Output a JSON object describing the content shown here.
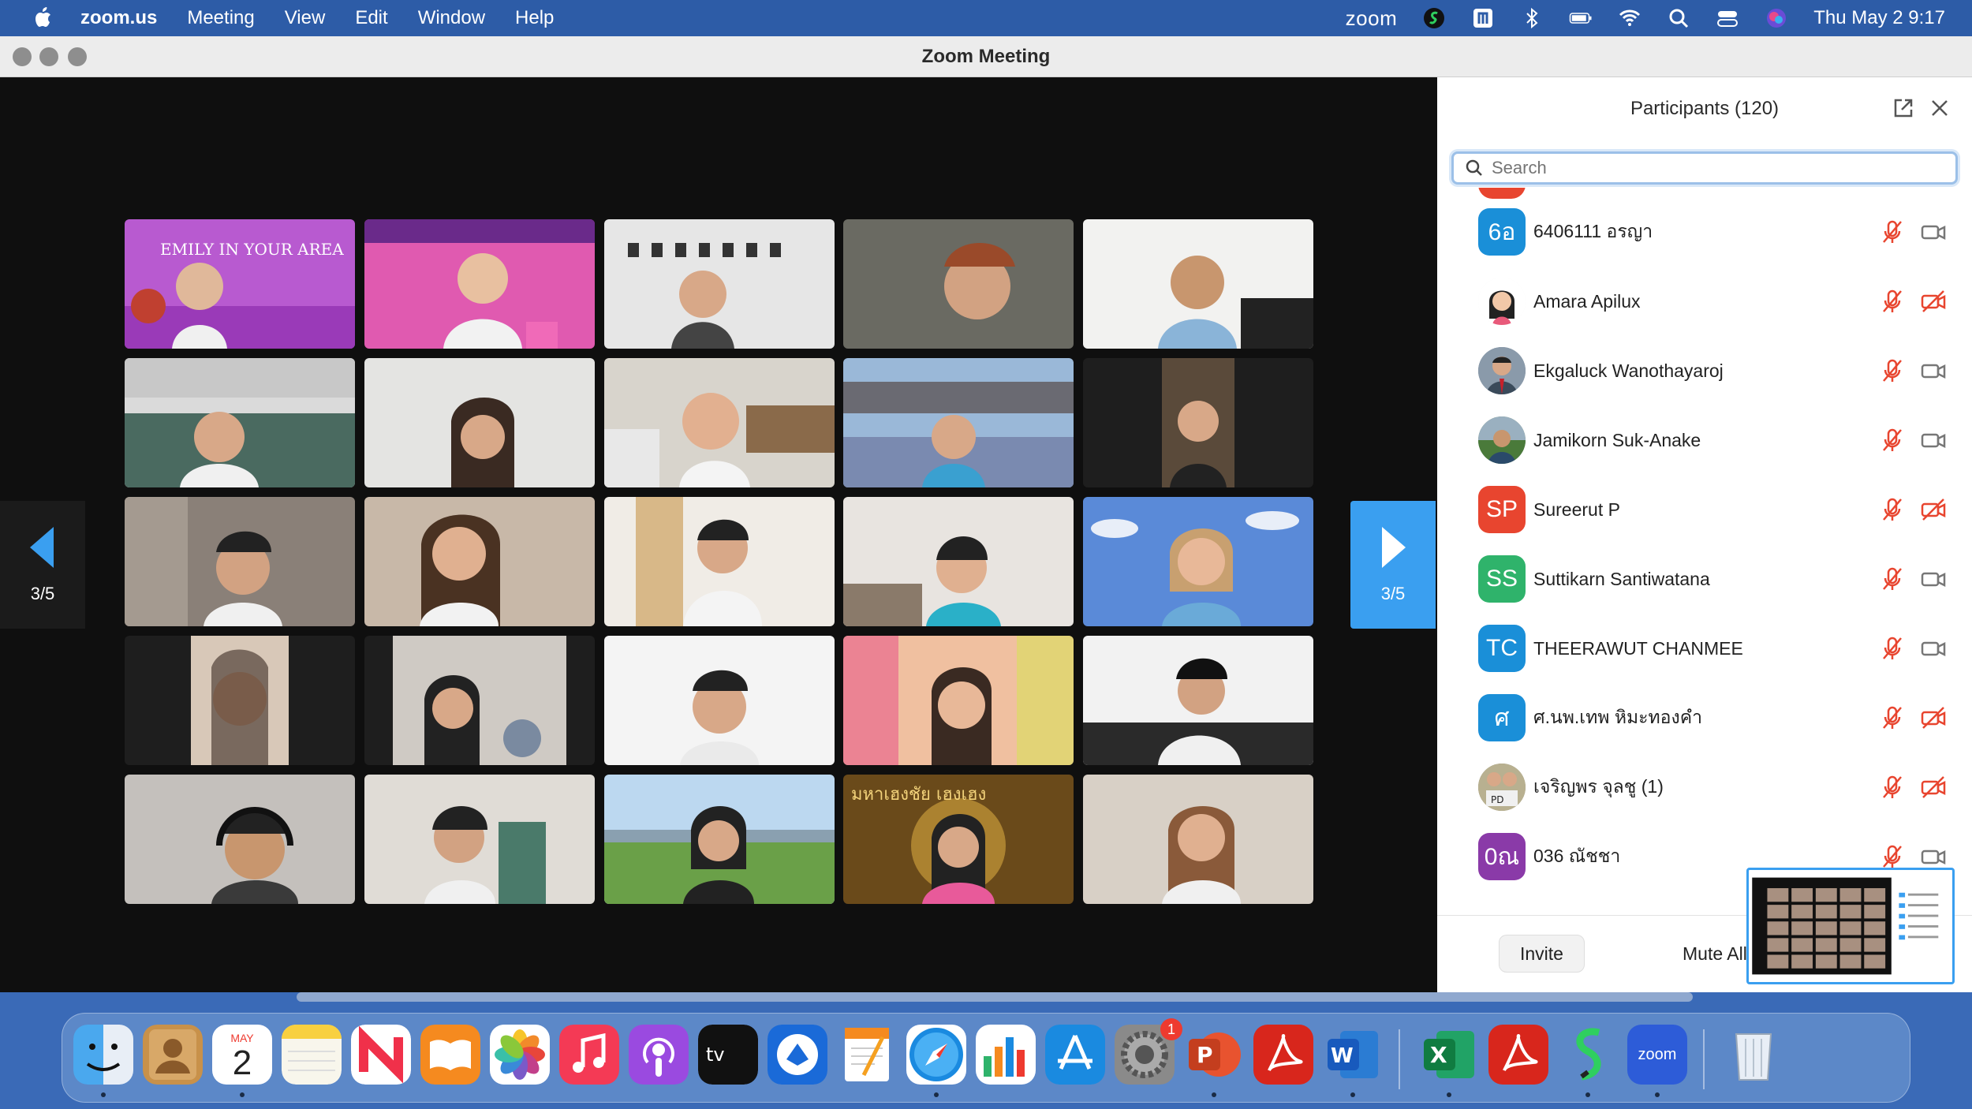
{
  "menubar": {
    "app_name": "zoom.us",
    "menus": [
      "Meeting",
      "View",
      "Edit",
      "Window",
      "Help"
    ],
    "zoom_label": "zoom",
    "datetime": "Thu May 2  9:17"
  },
  "window": {
    "title": "Zoom Meeting"
  },
  "gallery": {
    "page_indicator_prev": "3/5",
    "page_indicator_next": "3/5",
    "tile_count": 25
  },
  "participants": {
    "title": "Participants (120)",
    "search_placeholder": "Search",
    "list": [
      {
        "initials": "6อ",
        "name": "6406111 อรญา",
        "avatar_color": "#1a8fd8",
        "mic": "muted",
        "cam": "on"
      },
      {
        "initials": "",
        "name": "Amara Apilux",
        "avatar_color": "#f4f4f4",
        "mic": "muted",
        "cam": "off"
      },
      {
        "initials": "",
        "name": "Ekgaluck Wanothayaroj",
        "avatar_color": "#7a8a9a",
        "mic": "muted",
        "cam": "on"
      },
      {
        "initials": "",
        "name": "Jamikorn Suk-Anake",
        "avatar_color": "#6f8f5f",
        "mic": "muted",
        "cam": "on"
      },
      {
        "initials": "SP",
        "name": "Sureerut P",
        "avatar_color": "#e8452f",
        "mic": "muted",
        "cam": "off"
      },
      {
        "initials": "SS",
        "name": "Suttikarn Santiwatana",
        "avatar_color": "#2fb36b",
        "mic": "muted",
        "cam": "on"
      },
      {
        "initials": "TC",
        "name": "THEERAWUT CHANMEE",
        "avatar_color": "#1a8fd8",
        "mic": "muted",
        "cam": "on"
      },
      {
        "initials": "ศ",
        "name": "ศ.นพ.เทพ หิมะทองคำ",
        "avatar_color": "#1a8fd8",
        "mic": "muted",
        "cam": "off"
      },
      {
        "initials": "",
        "name": "เจริญพร จุลชู (1)",
        "avatar_color": "#8a8a6a",
        "mic": "muted",
        "cam": "off"
      },
      {
        "initials": "0ณ",
        "name": "036 ณัชชา",
        "avatar_color": "#8a3aa8",
        "mic": "muted",
        "cam": "on"
      }
    ],
    "invite_label": "Invite",
    "mute_all_label": "Mute All"
  },
  "dock": {
    "calendar_month": "MAY",
    "calendar_day": "2",
    "settings_badge": "1",
    "zoom_label": "zoom",
    "apps": [
      "finder",
      "contacts",
      "calendar",
      "notes",
      "news",
      "books",
      "photos",
      "music",
      "podcasts",
      "tv",
      "unknown-app",
      "pages",
      "safari",
      "numbers",
      "app-store",
      "system-preferences",
      "powerpoint",
      "acrobat",
      "word",
      "excel",
      "acrobat-reader",
      "scrivener",
      "zoom",
      "trash"
    ]
  },
  "colors": {
    "accent": "#3a9ff0",
    "menubar": "#2d5ca7",
    "mute_red": "#e8452f"
  }
}
